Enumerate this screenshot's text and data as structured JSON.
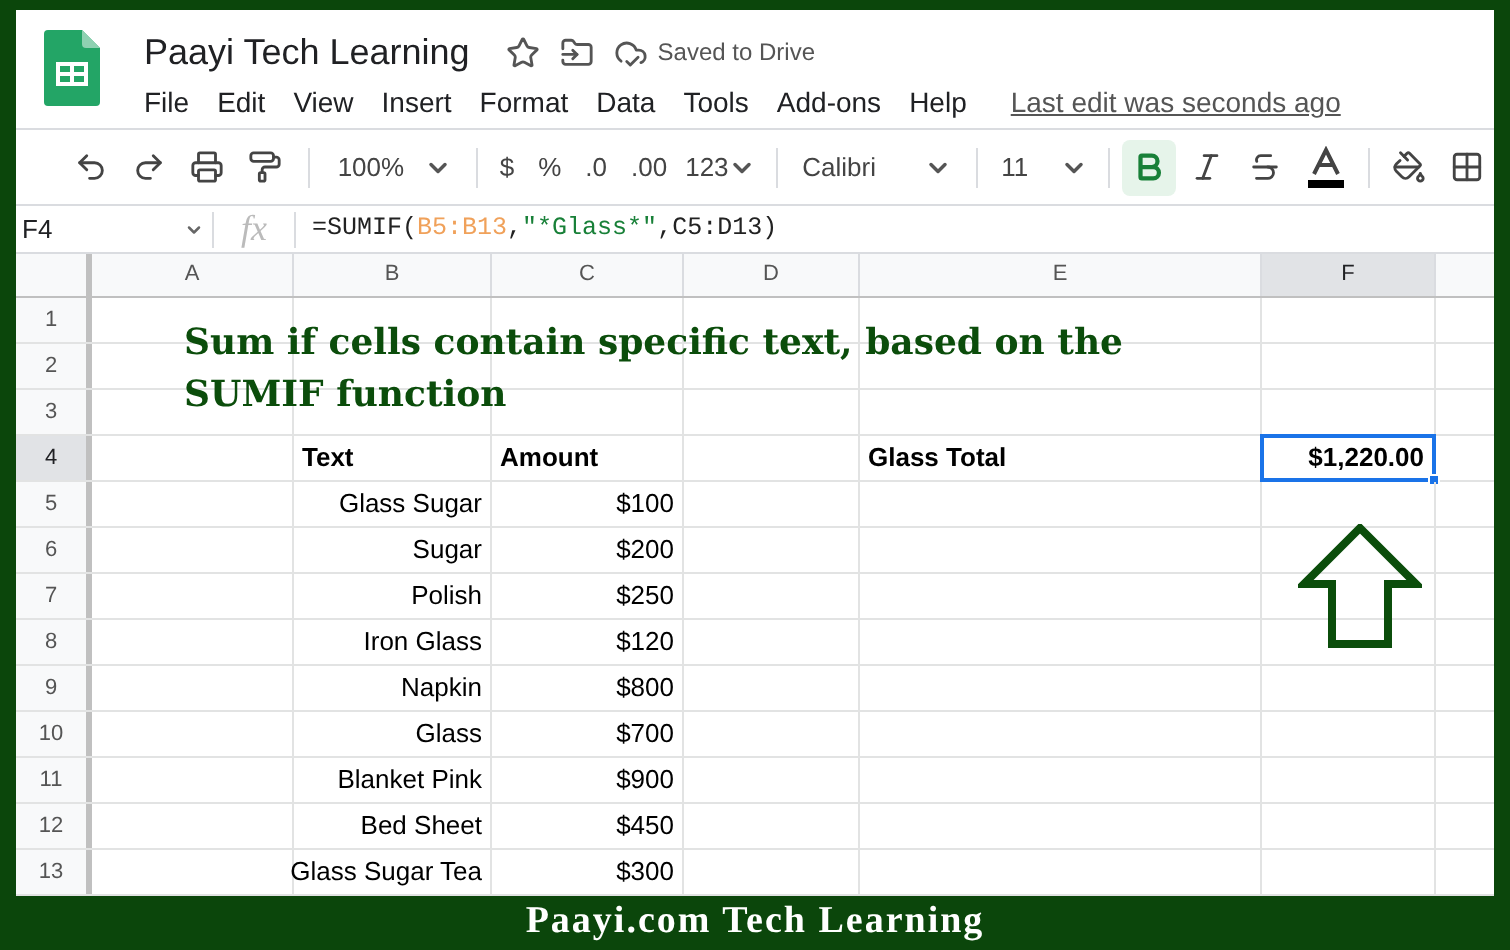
{
  "app": {
    "title": "Paayi Tech Learning",
    "saved_status": "Saved to Drive",
    "menus": [
      "File",
      "Edit",
      "View",
      "Insert",
      "Format",
      "Data",
      "Tools",
      "Add-ons",
      "Help"
    ],
    "last_edit": "Last edit was seconds ago"
  },
  "toolbar": {
    "zoom": "100%",
    "currency": "$",
    "percent": "%",
    "decrease_decimals": ".0",
    "increase_decimals": ".00",
    "more_formats": "123",
    "font": "Calibri",
    "font_size": "11",
    "bold_on": true
  },
  "formula_bar": {
    "cell_ref": "F4",
    "fx": "fx",
    "formula": [
      {
        "text": "=SUMIF(",
        "color": "#222222"
      },
      {
        "text": "B5:B13",
        "color": "#f0a15a"
      },
      {
        "text": ",",
        "color": "#222222"
      },
      {
        "text": "\"*Glass*\"",
        "color": "#188038"
      },
      {
        "text": ",C5:D13)",
        "color": "#222222"
      }
    ]
  },
  "sheet": {
    "heading": "Sum if cells contain specific text, based on the SUMIF function",
    "columns": [
      {
        "label": "A",
        "selected": false
      },
      {
        "label": "B",
        "selected": false
      },
      {
        "label": "C",
        "selected": false
      },
      {
        "label": "D",
        "selected": false
      },
      {
        "label": "E",
        "selected": false
      },
      {
        "label": "F",
        "selected": true
      }
    ],
    "rows": [
      {
        "number": "1",
        "selected": false,
        "kind": "data"
      },
      {
        "number": "2",
        "selected": false,
        "kind": "data"
      },
      {
        "number": "3",
        "selected": false,
        "kind": "data"
      },
      {
        "number": "4",
        "selected": true,
        "kind": "header",
        "cells": [
          "",
          "Text",
          "Amount",
          "",
          "Glass Total",
          "$1,220.00"
        ]
      },
      {
        "number": "5",
        "selected": false,
        "kind": "data",
        "cells": [
          "",
          "Glass Sugar",
          "$100"
        ]
      },
      {
        "number": "6",
        "selected": false,
        "kind": "data",
        "cells": [
          "",
          "Sugar",
          "$200"
        ]
      },
      {
        "number": "7",
        "selected": false,
        "kind": "data",
        "cells": [
          "",
          "Polish",
          "$250"
        ]
      },
      {
        "number": "8",
        "selected": false,
        "kind": "data",
        "cells": [
          "",
          "Iron Glass",
          "$120"
        ]
      },
      {
        "number": "9",
        "selected": false,
        "kind": "data",
        "cells": [
          "",
          "Napkin",
          "$800"
        ]
      },
      {
        "number": "10",
        "selected": false,
        "kind": "data",
        "cells": [
          "",
          "Glass",
          "$700"
        ]
      },
      {
        "number": "11",
        "selected": false,
        "kind": "data",
        "cells": [
          "",
          "Blanket Pink",
          "$900"
        ]
      },
      {
        "number": "12",
        "selected": false,
        "kind": "data",
        "cells": [
          "",
          "Bed Sheet",
          "$450"
        ]
      },
      {
        "number": "13",
        "selected": false,
        "kind": "data",
        "cells": [
          "",
          "Glass Sugar Tea",
          "$300"
        ]
      }
    ]
  },
  "footer": {
    "caption": "Paayi.com Tech Learning"
  }
}
